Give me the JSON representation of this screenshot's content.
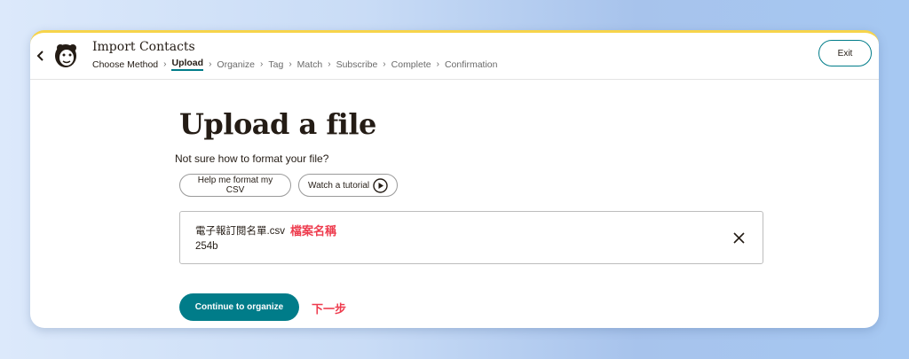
{
  "header": {
    "title": "Import Contacts",
    "steps": [
      "Choose Method",
      "Upload",
      "Organize",
      "Tag",
      "Match",
      "Subscribe",
      "Complete",
      "Confirmation"
    ],
    "active_step": "Upload",
    "exit_label": "Exit"
  },
  "main": {
    "title": "Upload a file",
    "help_question": "Not sure how to format your file?",
    "help_button": "Help me format my CSV",
    "tutorial_button": "Watch a tutorial",
    "file": {
      "name": "電子報訂閱名單.csv",
      "annotation": "檔案名稱",
      "size": "254b"
    },
    "continue_button": "Continue to organize",
    "continue_annotation": "下一步"
  },
  "colors": {
    "accent": "#007c89",
    "annotation": "#ee3c4e",
    "top_border": "#f7d44a"
  },
  "icons": [
    "back-icon",
    "mailchimp-logo",
    "chevron-right-icon",
    "play-icon",
    "close-icon"
  ]
}
